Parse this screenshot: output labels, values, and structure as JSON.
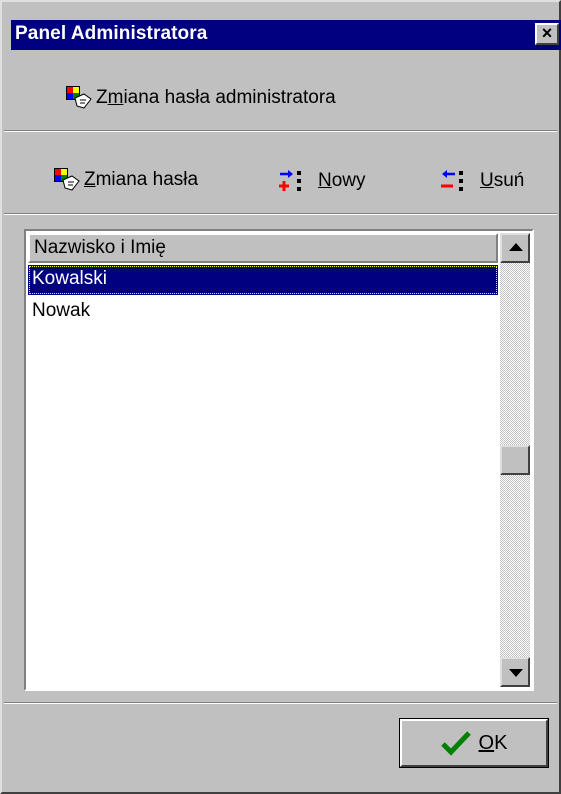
{
  "window": {
    "title": "Panel Administratora",
    "close_glyph": "×"
  },
  "top_toolbar": {
    "admin_password": {
      "label_pre": "Z",
      "label_mn": "m",
      "label_post": "iana hasła administratora",
      "icon": "password-change-icon"
    }
  },
  "toolbar": {
    "change_password": {
      "label_mn": "Z",
      "label_post": "miana hasła",
      "icon": "password-change-icon"
    },
    "new": {
      "label_mn": "N",
      "label_post": "owy",
      "icon": "add-user-icon"
    },
    "delete": {
      "label_mn": "U",
      "label_post": "suń",
      "icon": "remove-user-icon"
    }
  },
  "list": {
    "column_header": "Nazwisko i Imię",
    "rows": [
      "Kowalski",
      "Nowak"
    ],
    "selected_index": 0
  },
  "ok_button": {
    "label_mn": "O",
    "label_post": "K",
    "icon": "checkmark-icon"
  },
  "colors": {
    "title_bar": "#000080",
    "face": "#c0c0c0",
    "selection": "#000080",
    "check": "#008000"
  }
}
